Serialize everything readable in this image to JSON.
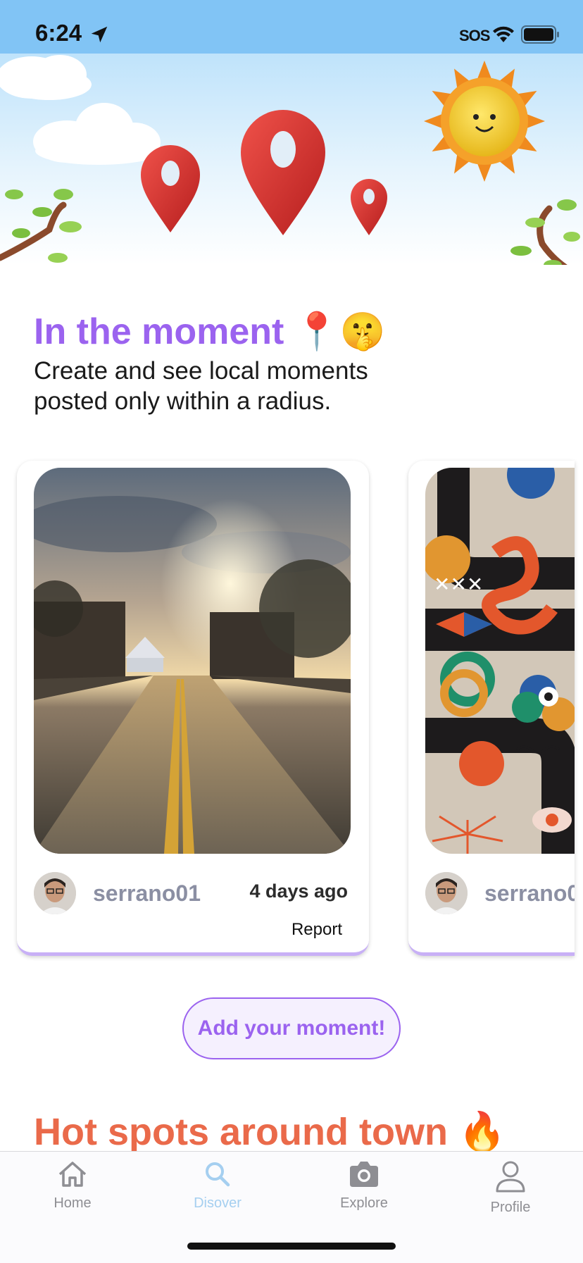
{
  "status_bar": {
    "time": "6:24",
    "sos": "SOS"
  },
  "moments": {
    "title": "In the moment 📍🤫",
    "subtitle": "Create and see local moments posted only within a radius.",
    "cards": [
      {
        "username": "serrano01",
        "time_ago": "4 days ago",
        "report_label": "Report"
      },
      {
        "username": "serrano0"
      }
    ],
    "add_button": "Add your moment!"
  },
  "hot_spots": {
    "title": "Hot spots around town 🔥"
  },
  "tab_bar": {
    "active": "Disover",
    "items": [
      {
        "label": "Home",
        "icon": "home-icon"
      },
      {
        "label": "Disover",
        "icon": "search-icon"
      },
      {
        "label": "Explore",
        "icon": "camera-icon"
      },
      {
        "label": "Profile",
        "icon": "person-icon"
      }
    ]
  },
  "colors": {
    "accent": "#9b63ef",
    "hot": "#ea6a4a",
    "active_tab": "#a5cff0"
  }
}
